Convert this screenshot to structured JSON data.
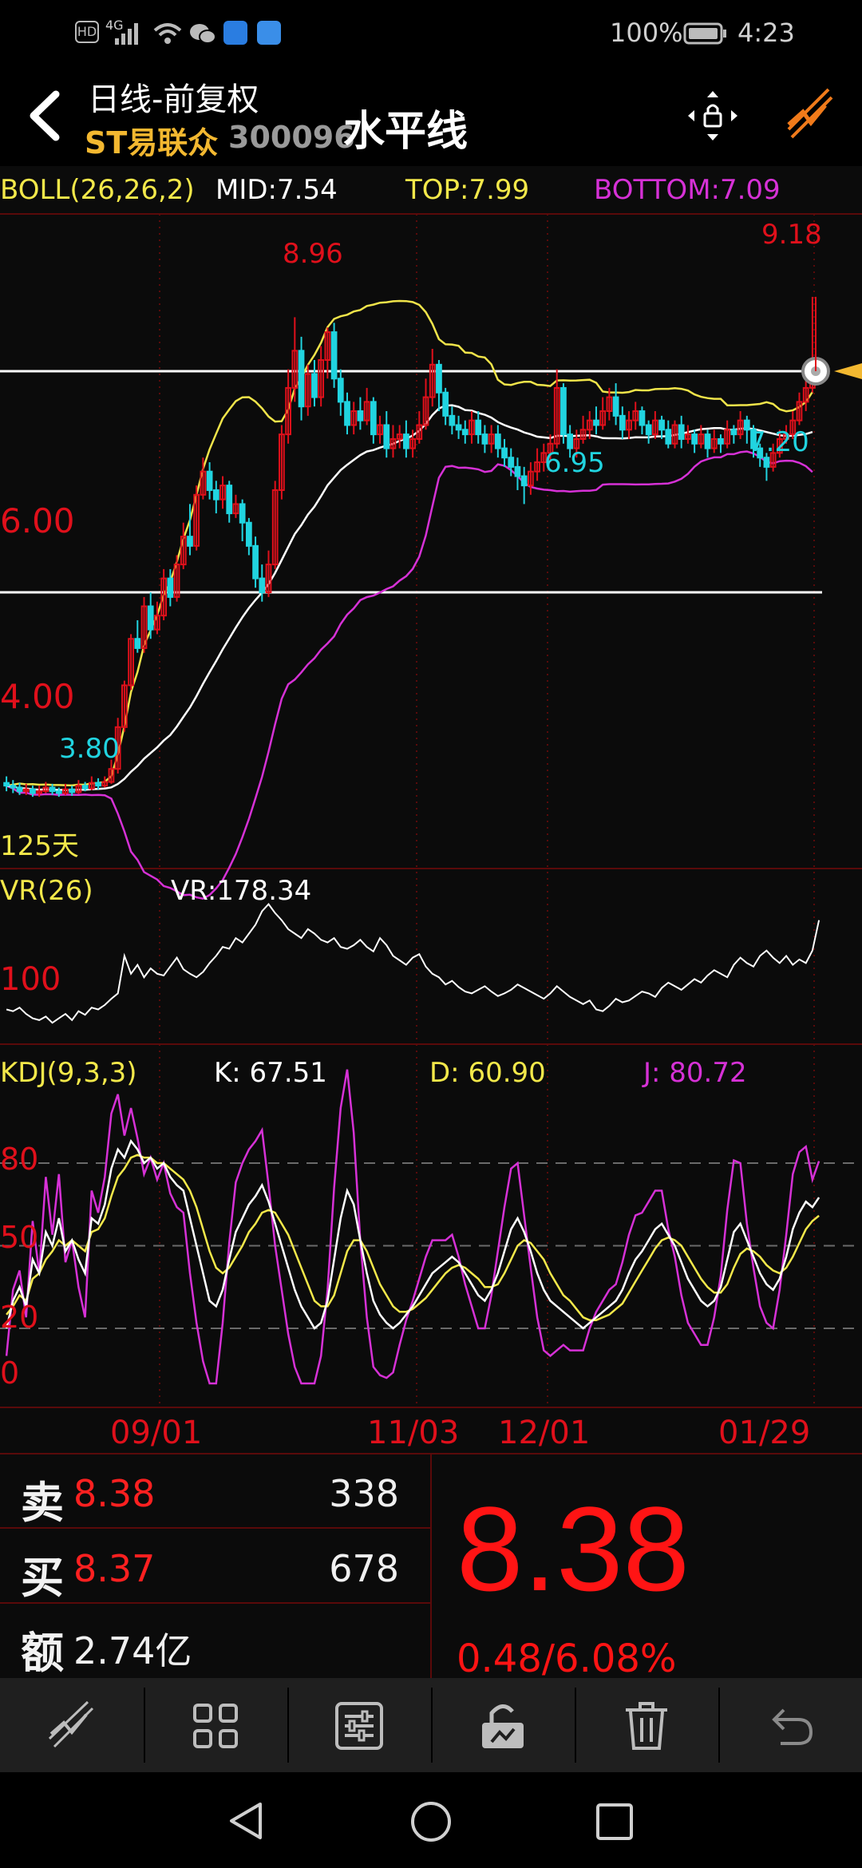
{
  "status_bar": {
    "battery": "100%",
    "time": "4:23",
    "hd": "HD",
    "net": "4G"
  },
  "header": {
    "title": "日线-前复权",
    "stock_name": "ST易联众",
    "stock_code": "300096",
    "tool_label": "水平线"
  },
  "colors": {
    "up": "#e0101b",
    "down": "#21d4e0",
    "mid": "#ffffff",
    "top": "#f0e44a",
    "bottom": "#d631d6",
    "price": "#ff1414",
    "yellow": "#f3e84a",
    "magenta": "#d631d6",
    "grid": "#5a0a0a"
  },
  "indicators": {
    "boll": {
      "name": "BOLL(26,26,2)",
      "mid": "MID:7.54",
      "top": "TOP:7.99",
      "bottom": "BOTTOM:7.09"
    },
    "vr": {
      "name": "VR(26)",
      "value": "VR:178.34",
      "level": "100"
    },
    "kdj": {
      "name": "KDJ(9,3,3)",
      "k": "K: 67.51",
      "d": "D: 60.90",
      "j": "J: 80.72",
      "levels": [
        "80",
        "50",
        "20",
        "0"
      ]
    }
  },
  "chart_data": {
    "type": "candlestick",
    "period_label": "125天",
    "x_ticks": [
      "09/01",
      "11/03",
      "12/01",
      "01/29"
    ],
    "y_labels": [
      "6.00",
      "4.00"
    ],
    "annotations": {
      "high": "8.96",
      "latest_high": "9.18",
      "low_left": "3.80",
      "low_mid": "6.95",
      "low_right": "7.20"
    },
    "horizontal_lines": [
      8.38,
      6.0
    ],
    "price_range": [
      3.2,
      9.9
    ],
    "candles": [
      [
        3.95,
        3.92,
        4.02,
        3.86
      ],
      [
        3.92,
        3.9,
        3.98,
        3.84
      ],
      [
        3.9,
        3.86,
        3.95,
        3.82
      ],
      [
        3.86,
        3.88,
        3.94,
        3.82
      ],
      [
        3.88,
        3.84,
        3.92,
        3.8
      ],
      [
        3.84,
        3.86,
        3.92,
        3.8
      ],
      [
        3.86,
        3.9,
        3.96,
        3.84
      ],
      [
        3.9,
        3.86,
        3.94,
        3.82
      ],
      [
        3.86,
        3.84,
        3.9,
        3.8
      ],
      [
        3.84,
        3.88,
        3.94,
        3.82
      ],
      [
        3.88,
        3.85,
        3.92,
        3.81
      ],
      [
        3.85,
        3.92,
        3.98,
        3.83
      ],
      [
        3.92,
        3.89,
        3.96,
        3.86
      ],
      [
        3.89,
        3.95,
        4.02,
        3.87
      ],
      [
        3.95,
        3.92,
        4.0,
        3.88
      ],
      [
        3.92,
        3.96,
        4.02,
        3.9
      ],
      [
        3.96,
        4.1,
        4.2,
        3.94
      ],
      [
        4.1,
        4.55,
        4.65,
        4.05
      ],
      [
        4.55,
        5.0,
        5.05,
        4.5
      ],
      [
        5.0,
        5.5,
        5.55,
        4.95
      ],
      [
        5.5,
        5.4,
        5.7,
        5.35
      ],
      [
        5.4,
        5.85,
        5.95,
        5.35
      ],
      [
        5.85,
        5.6,
        6.0,
        5.5
      ],
      [
        5.6,
        5.75,
        5.9,
        5.55
      ],
      [
        5.75,
        6.15,
        6.25,
        5.7
      ],
      [
        6.15,
        5.95,
        6.25,
        5.85
      ],
      [
        5.95,
        6.3,
        6.4,
        5.9
      ],
      [
        6.3,
        6.6,
        6.75,
        6.25
      ],
      [
        6.6,
        6.5,
        6.95,
        6.4
      ],
      [
        6.5,
        7.05,
        7.15,
        6.45
      ],
      [
        7.05,
        7.3,
        7.45,
        7.0
      ],
      [
        7.3,
        7.1,
        7.4,
        7.0
      ],
      [
        7.1,
        7.0,
        7.2,
        6.85
      ],
      [
        7.0,
        7.15,
        7.25,
        6.9
      ],
      [
        7.15,
        6.85,
        7.2,
        6.75
      ],
      [
        6.85,
        6.95,
        7.05,
        6.8
      ],
      [
        6.95,
        6.75,
        7.0,
        6.55
      ],
      [
        6.75,
        6.5,
        6.8,
        6.4
      ],
      [
        6.5,
        6.15,
        6.6,
        6.05
      ],
      [
        6.15,
        6.0,
        6.3,
        5.9
      ],
      [
        6.0,
        6.3,
        6.45,
        5.95
      ],
      [
        6.3,
        7.1,
        7.2,
        6.25
      ],
      [
        7.1,
        7.7,
        7.8,
        7.0
      ],
      [
        7.7,
        8.2,
        8.4,
        7.6
      ],
      [
        8.2,
        8.6,
        8.96,
        8.05
      ],
      [
        8.6,
        8.0,
        8.75,
        7.85
      ],
      [
        8.0,
        8.35,
        8.45,
        7.9
      ],
      [
        8.35,
        8.1,
        8.5,
        8.0
      ],
      [
        8.1,
        8.5,
        8.65,
        8.0
      ],
      [
        8.5,
        8.8,
        8.85,
        8.3
      ],
      [
        8.8,
        8.3,
        8.9,
        8.2
      ],
      [
        8.3,
        8.05,
        8.4,
        7.9
      ],
      [
        8.05,
        7.8,
        8.15,
        7.7
      ],
      [
        7.8,
        7.95,
        8.05,
        7.7
      ],
      [
        7.95,
        7.85,
        8.1,
        7.75
      ],
      [
        7.85,
        8.05,
        8.2,
        7.8
      ],
      [
        8.05,
        7.7,
        8.1,
        7.6
      ],
      [
        7.7,
        7.8,
        7.9,
        7.6
      ],
      [
        7.8,
        7.55,
        7.95,
        7.45
      ],
      [
        7.55,
        7.65,
        7.8,
        7.45
      ],
      [
        7.65,
        7.7,
        7.8,
        7.55
      ],
      [
        7.7,
        7.55,
        7.85,
        7.45
      ],
      [
        7.55,
        7.65,
        7.75,
        7.45
      ],
      [
        7.65,
        7.8,
        7.95,
        7.6
      ],
      [
        7.8,
        8.1,
        8.3,
        7.75
      ],
      [
        8.1,
        8.45,
        8.62,
        8.0
      ],
      [
        8.45,
        8.15,
        8.5,
        7.95
      ],
      [
        8.15,
        7.9,
        8.2,
        7.8
      ],
      [
        7.9,
        7.8,
        8.0,
        7.7
      ],
      [
        7.8,
        7.75,
        7.9,
        7.65
      ],
      [
        7.75,
        7.7,
        7.85,
        7.6
      ],
      [
        7.7,
        7.85,
        7.95,
        7.6
      ],
      [
        7.85,
        7.7,
        7.95,
        7.6
      ],
      [
        7.7,
        7.6,
        7.8,
        7.5
      ],
      [
        7.6,
        7.7,
        7.8,
        7.5
      ],
      [
        7.7,
        7.55,
        7.8,
        7.45
      ],
      [
        7.55,
        7.45,
        7.65,
        7.35
      ],
      [
        7.45,
        7.35,
        7.55,
        7.25
      ],
      [
        7.35,
        7.25,
        7.45,
        7.1
      ],
      [
        7.25,
        7.15,
        7.35,
        6.95
      ],
      [
        7.15,
        7.3,
        7.4,
        7.05
      ],
      [
        7.3,
        7.4,
        7.55,
        7.2
      ],
      [
        7.4,
        7.5,
        7.6,
        7.3
      ],
      [
        7.5,
        7.6,
        7.7,
        7.4
      ],
      [
        7.6,
        8.2,
        8.4,
        7.55
      ],
      [
        8.2,
        7.7,
        8.25,
        7.6
      ],
      [
        7.7,
        7.55,
        7.8,
        7.45
      ],
      [
        7.55,
        7.65,
        7.75,
        7.45
      ],
      [
        7.65,
        7.75,
        7.9,
        7.6
      ],
      [
        7.75,
        7.85,
        7.95,
        7.65
      ],
      [
        7.85,
        7.8,
        8.0,
        7.7
      ],
      [
        7.8,
        7.95,
        8.1,
        7.75
      ],
      [
        7.95,
        8.1,
        8.2,
        7.85
      ],
      [
        8.1,
        7.9,
        8.25,
        7.8
      ],
      [
        7.9,
        7.75,
        8.0,
        7.65
      ],
      [
        7.75,
        7.85,
        7.95,
        7.65
      ],
      [
        7.85,
        7.95,
        8.05,
        7.75
      ],
      [
        7.95,
        7.8,
        8.0,
        7.7
      ],
      [
        7.8,
        7.7,
        7.85,
        7.6
      ],
      [
        7.7,
        7.85,
        7.95,
        7.65
      ],
      [
        7.85,
        7.75,
        7.9,
        7.65
      ],
      [
        7.75,
        7.6,
        7.85,
        7.55
      ],
      [
        7.6,
        7.8,
        7.85,
        7.55
      ],
      [
        7.8,
        7.65,
        7.9,
        7.55
      ],
      [
        7.65,
        7.7,
        7.8,
        7.6
      ],
      [
        7.7,
        7.6,
        7.75,
        7.5
      ],
      [
        7.6,
        7.7,
        7.8,
        7.55
      ],
      [
        7.7,
        7.55,
        7.75,
        7.45
      ],
      [
        7.55,
        7.65,
        7.75,
        7.5
      ],
      [
        7.65,
        7.6,
        7.7,
        7.5
      ],
      [
        7.6,
        7.75,
        7.85,
        7.55
      ],
      [
        7.75,
        7.7,
        7.8,
        7.6
      ],
      [
        7.7,
        7.85,
        7.95,
        7.65
      ],
      [
        7.85,
        7.75,
        7.9,
        7.6
      ],
      [
        7.75,
        7.55,
        7.8,
        7.45
      ],
      [
        7.55,
        7.45,
        7.6,
        7.35
      ],
      [
        7.45,
        7.35,
        7.5,
        7.2
      ],
      [
        7.35,
        7.5,
        7.6,
        7.3
      ],
      [
        7.5,
        7.65,
        7.75,
        7.45
      ],
      [
        7.65,
        7.7,
        7.8,
        7.6
      ],
      [
        7.7,
        7.85,
        7.95,
        7.65
      ],
      [
        7.85,
        8.05,
        8.15,
        7.8
      ],
      [
        8.05,
        8.2,
        8.3,
        7.95
      ],
      [
        8.2,
        8.38,
        9.18,
        8.15
      ]
    ],
    "vr_values": [
      60,
      58,
      62,
      55,
      50,
      48,
      52,
      45,
      50,
      55,
      48,
      58,
      54,
      62,
      60,
      65,
      72,
      78,
      120,
      100,
      110,
      96,
      106,
      100,
      98,
      108,
      118,
      105,
      100,
      96,
      102,
      112,
      120,
      130,
      128,
      140,
      135,
      145,
      155,
      170,
      178,
      168,
      160,
      150,
      145,
      140,
      150,
      145,
      138,
      135,
      140,
      130,
      128,
      132,
      138,
      130,
      125,
      140,
      132,
      120,
      115,
      110,
      118,
      122,
      108,
      100,
      96,
      88,
      92,
      85,
      80,
      78,
      82,
      86,
      80,
      75,
      78,
      82,
      88,
      84,
      80,
      76,
      72,
      78,
      86,
      80,
      74,
      70,
      66,
      70,
      60,
      58,
      64,
      72,
      68,
      70,
      75,
      80,
      78,
      74,
      84,
      90,
      86,
      82,
      88,
      94,
      90,
      98,
      104,
      100,
      96,
      110,
      118,
      112,
      108,
      120,
      126,
      118,
      112,
      120,
      110,
      116,
      112,
      126,
      160
    ],
    "kdj": {
      "k": [
        20,
        30,
        35,
        28,
        45,
        40,
        55,
        50,
        60,
        48,
        52,
        45,
        40,
        60,
        58,
        65,
        78,
        85,
        82,
        88,
        85,
        80,
        82,
        78,
        80,
        75,
        72,
        70,
        60,
        50,
        40,
        30,
        28,
        34,
        45,
        55,
        60,
        65,
        68,
        72,
        66,
        58,
        50,
        42,
        34,
        28,
        24,
        20,
        22,
        30,
        45,
        60,
        70,
        65,
        52,
        40,
        30,
        25,
        22,
        20,
        22,
        25,
        28,
        32,
        36,
        40,
        42,
        44,
        46,
        44,
        40,
        36,
        32,
        30,
        34,
        40,
        48,
        56,
        60,
        55,
        48,
        40,
        34,
        30,
        28,
        26,
        24,
        22,
        20,
        22,
        24,
        26,
        28,
        30,
        34,
        40,
        45,
        48,
        52,
        56,
        58,
        54,
        50,
        44,
        38,
        34,
        30,
        28,
        30,
        35,
        45,
        55,
        58,
        52,
        46,
        40,
        36,
        34,
        38,
        46,
        56,
        62,
        66,
        64,
        67.5
      ],
      "d": [
        25,
        28,
        32,
        30,
        38,
        40,
        45,
        48,
        52,
        50,
        52,
        50,
        48,
        55,
        56,
        60,
        68,
        75,
        78,
        82,
        83,
        82,
        82,
        80,
        80,
        78,
        76,
        74,
        70,
        64,
        56,
        48,
        42,
        40,
        42,
        46,
        50,
        55,
        58,
        62,
        63,
        62,
        58,
        54,
        48,
        42,
        36,
        30,
        28,
        28,
        32,
        40,
        48,
        52,
        52,
        48,
        42,
        36,
        32,
        28,
        26,
        26,
        27,
        29,
        31,
        34,
        37,
        40,
        42,
        43,
        42,
        40,
        38,
        35,
        35,
        36,
        40,
        45,
        50,
        52,
        51,
        48,
        45,
        40,
        36,
        32,
        30,
        27,
        24,
        23,
        23,
        24,
        25,
        27,
        29,
        33,
        37,
        41,
        45,
        49,
        52,
        53,
        52,
        50,
        46,
        42,
        38,
        35,
        33,
        33,
        36,
        42,
        47,
        49,
        48,
        46,
        43,
        41,
        40,
        42,
        46,
        51,
        56,
        59,
        60.9
      ],
      "j": [
        10,
        34,
        41,
        24,
        59,
        40,
        75,
        54,
        76,
        44,
        52,
        35,
        24,
        70,
        62,
        75,
        98,
        105,
        90,
        100,
        89,
        76,
        82,
        74,
        80,
        69,
        64,
        62,
        40,
        22,
        8,
        0,
        0,
        22,
        51,
        73,
        80,
        85,
        88,
        92,
        72,
        50,
        34,
        18,
        6,
        0,
        0,
        0,
        10,
        34,
        71,
        100,
        114,
        91,
        52,
        24,
        6,
        3,
        2,
        4,
        14,
        23,
        30,
        38,
        46,
        52,
        52,
        52,
        54,
        46,
        36,
        28,
        20,
        20,
        32,
        48,
        64,
        78,
        80,
        61,
        42,
        24,
        12,
        10,
        12,
        14,
        12,
        12,
        12,
        20,
        26,
        30,
        34,
        36,
        44,
        54,
        61,
        62,
        66,
        70,
        70,
        56,
        46,
        32,
        22,
        18,
        14,
        14,
        24,
        39,
        63,
        81,
        80,
        58,
        42,
        28,
        22,
        20,
        34,
        54,
        76,
        84,
        86,
        74,
        80.7
      ]
    }
  }
}
